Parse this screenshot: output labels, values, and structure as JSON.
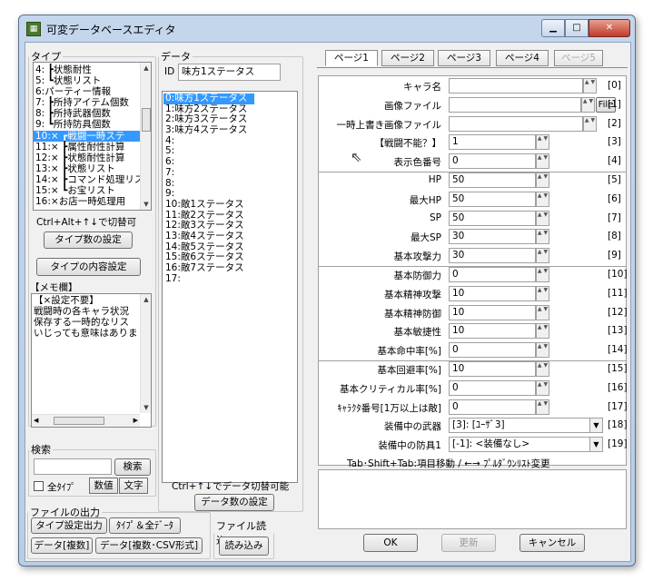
{
  "window": {
    "title": "可変データベースエディタ",
    "icon": "app-icon",
    "minimize": "minimize-icon",
    "maximize": "maximize-icon",
    "close": "close-icon"
  },
  "type_panel": {
    "legend": "タイプ",
    "items": [
      "4: ┣状態耐性",
      "5: ┗状態リスト",
      "6:パーティー情報",
      "7: ┣所持アイテム個数",
      "8: ┣所持武器個数",
      "9: ┗所持防具個数",
      "10:× ┏戦闘一時ステ",
      "11:× ┣属性耐性計算",
      "12:× ┣状態耐性計算",
      "13:× ┣状態リスト",
      "14:× ┣コマンド処理リス",
      "15:× ┗お宝リスト",
      "16:×お店一時処理用"
    ],
    "selected_index": 6,
    "hint": "Ctrl+Alt+↑↓で切替可",
    "count_button": "タイプ数の設定",
    "content_button": "タイプの内容設定"
  },
  "memo": {
    "label": "【メモ欄】",
    "lines": [
      "【×設定不要】",
      "戦闘時の各キャラ状況",
      "保存する一時的なリス",
      "いじっても意味はありま"
    ]
  },
  "search": {
    "legend": "検索",
    "button": "検索",
    "all_types": "全ﾀｲﾌﾟ",
    "numeric": "数値",
    "text": "文字"
  },
  "file_output": {
    "legend": "ファイルの出力",
    "type_settings": "タイプ設定出力",
    "type_all_data": "ﾀｲﾌﾟ＆全ﾃﾞｰﾀ",
    "data_multi": "データ[複数]",
    "data_csv": "データ[複数･CSV形式]"
  },
  "file_input": {
    "legend": "ファイル読込",
    "button": "読み込み"
  },
  "data_panel": {
    "legend": "データ",
    "id_label": "ID",
    "id_value": "味方1ステータス",
    "items": [
      "0:味方1ステータス",
      "1:味方2ステータス",
      "2:味方3ステータス",
      "3:味方4ステータス",
      "4:",
      "5:",
      "6:",
      "7:",
      "8:",
      "9:",
      "10:敵1ステータス",
      "11:敵2ステータス",
      "12:敵3ステータス",
      "13:敵4ステータス",
      "14:敵5ステータス",
      "15:敵6ステータス",
      "16:敵7ステータス",
      "17:"
    ],
    "selected_index": 0,
    "hint": "Ctrl+↑↓でデータ切替可能",
    "count_button": "データ数の設定"
  },
  "tabs": [
    {
      "label": "ページ1",
      "active": true,
      "enabled": true
    },
    {
      "label": "ページ2",
      "active": false,
      "enabled": true
    },
    {
      "label": "ページ3",
      "active": false,
      "enabled": true
    },
    {
      "label": "ページ4",
      "active": false,
      "enabled": true
    },
    {
      "label": "ページ5",
      "active": false,
      "enabled": false
    }
  ],
  "fields": [
    {
      "label": "キャラ名",
      "value": "",
      "index": "[0]",
      "kind": "text"
    },
    {
      "label": "画像ファイル",
      "value": "",
      "index": "[1]",
      "kind": "file",
      "button": "File"
    },
    {
      "label": "一時上書き画像ファイル",
      "value": "",
      "index": "[2]",
      "kind": "text"
    },
    {
      "label": "【戦闘不能？】",
      "value": "1",
      "index": "[3]",
      "kind": "num"
    },
    {
      "label": "表示色番号",
      "value": "0",
      "index": "[4]",
      "kind": "num"
    },
    {
      "label": "HP",
      "value": "50",
      "index": "[5]",
      "kind": "num"
    },
    {
      "label": "最大HP",
      "value": "50",
      "index": "[6]",
      "kind": "num"
    },
    {
      "label": "SP",
      "value": "50",
      "index": "[7]",
      "kind": "num"
    },
    {
      "label": "最大SP",
      "value": "30",
      "index": "[8]",
      "kind": "num"
    },
    {
      "label": "基本攻撃力",
      "value": "30",
      "index": "[9]",
      "kind": "num"
    },
    {
      "label": "基本防御力",
      "value": "0",
      "index": "[10]",
      "kind": "num"
    },
    {
      "label": "基本精神攻撃",
      "value": "10",
      "index": "[11]",
      "kind": "num"
    },
    {
      "label": "基本精神防御",
      "value": "10",
      "index": "[12]",
      "kind": "num"
    },
    {
      "label": "基本敏捷性",
      "value": "10",
      "index": "[13]",
      "kind": "num"
    },
    {
      "label": "基本命中率[%]",
      "value": "0",
      "index": "[14]",
      "kind": "num"
    },
    {
      "label": "基本回避率[%]",
      "value": "10",
      "index": "[15]",
      "kind": "num"
    },
    {
      "label": "基本クリティカル率[%]",
      "value": "0",
      "index": "[16]",
      "kind": "num"
    },
    {
      "label": "ｷｬﾗｸﾀ番号[1万以上は敵]",
      "value": "0",
      "index": "[17]",
      "kind": "num"
    },
    {
      "label": "装備中の武器",
      "value": "[3]: [ﾕｰｻﾞ3]",
      "index": "[18]",
      "kind": "combo"
    },
    {
      "label": "装備中の防具1",
      "value": "[-1]: <装備なし>",
      "index": "[19]",
      "kind": "combo"
    }
  ],
  "nav_hint": "Tab･Shift+Tab:項目移動 / ←→ ﾌﾟﾙﾀﾞｳﾝﾘｽﾄ変更",
  "buttons": {
    "ok": "OK",
    "update": "更新",
    "cancel": "キャンセル"
  }
}
